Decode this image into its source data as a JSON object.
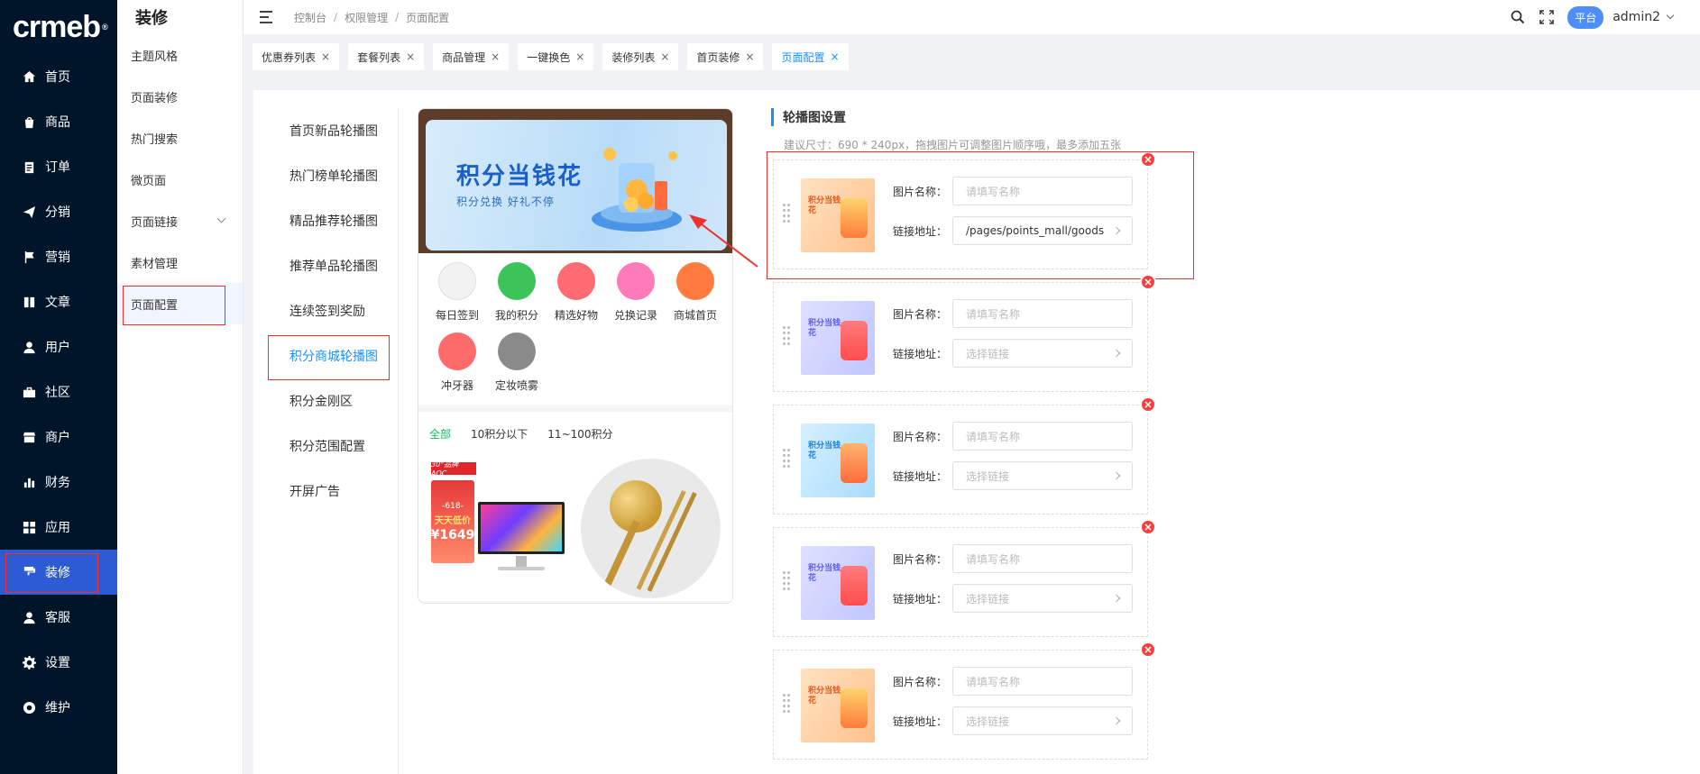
{
  "logo": "crmeb",
  "logo_mark": "®",
  "nav": {
    "items": [
      {
        "label": "首页",
        "icon": "home-icon"
      },
      {
        "label": "商品",
        "icon": "shopping-bag-icon"
      },
      {
        "label": "订单",
        "icon": "clipboard-icon"
      },
      {
        "label": "分销",
        "icon": "paper-plane-icon"
      },
      {
        "label": "营销",
        "icon": "flag-icon"
      },
      {
        "label": "文章",
        "icon": "book-icon"
      },
      {
        "label": "用户",
        "icon": "user-icon"
      },
      {
        "label": "社区",
        "icon": "briefcase-icon"
      },
      {
        "label": "商户",
        "icon": "store-icon"
      },
      {
        "label": "财务",
        "icon": "bar-chart-icon"
      },
      {
        "label": "应用",
        "icon": "apps-icon"
      },
      {
        "label": "装修",
        "icon": "paint-roller-icon"
      },
      {
        "label": "客服",
        "icon": "headset-icon"
      },
      {
        "label": "设置",
        "icon": "gear-icon"
      },
      {
        "label": "维护",
        "icon": "wrench-icon"
      }
    ]
  },
  "subnav": {
    "title": "装修",
    "items": [
      {
        "label": "主题风格"
      },
      {
        "label": "页面装修"
      },
      {
        "label": "热门搜索"
      },
      {
        "label": "微页面"
      },
      {
        "label": "页面链接"
      },
      {
        "label": "素材管理"
      },
      {
        "label": "页面配置"
      }
    ]
  },
  "header": {
    "breadcrumbs": [
      "控制台",
      "权限管理",
      "页面配置"
    ],
    "separator": "/",
    "platform_label": "平台",
    "user_name": "admin2"
  },
  "tabs": [
    {
      "label": "优惠券列表"
    },
    {
      "label": "套餐列表"
    },
    {
      "label": "商品管理"
    },
    {
      "label": "一键换色"
    },
    {
      "label": "装修列表"
    },
    {
      "label": "首页装修"
    },
    {
      "label": "页面配置"
    }
  ],
  "tab_close": "×",
  "config_list": [
    {
      "label": "首页新品轮播图"
    },
    {
      "label": "热门榜单轮播图"
    },
    {
      "label": "精品推荐轮播图"
    },
    {
      "label": "推荐单品轮播图"
    },
    {
      "label": "连续签到奖励"
    },
    {
      "label": "积分商城轮播图"
    },
    {
      "label": "积分金刚区"
    },
    {
      "label": "积分范围配置"
    },
    {
      "label": "开屏广告"
    }
  ],
  "preview": {
    "banner_title": "积分当钱花",
    "banner_subtitle": "积分兑换  好礼不停",
    "icons": [
      {
        "label": "每日签到",
        "color": "#f2f2f2"
      },
      {
        "label": "我的积分",
        "color": "#3cc35a"
      },
      {
        "label": "精选好物",
        "color": "#ff6b73"
      },
      {
        "label": "兑换记录",
        "color": "#ff7ab8"
      },
      {
        "label": "商城首页",
        "color": "#ff7a3d"
      },
      {
        "label": "冲牙器",
        "color": "#ff6b6b"
      },
      {
        "label": "定妆喷雾",
        "color": "#8a8a8a"
      }
    ],
    "categories": [
      "全部",
      "10积分以下",
      "11~100积分"
    ],
    "product_badge": "30°品牌 AOC",
    "poster_618": "-618-",
    "poster_text": "天天低价",
    "poster_price": "¥1649"
  },
  "settings": {
    "title": "轮播图设置",
    "hint": "建议尺寸：690 * 240px，拖拽图片可调整图片顺序哦，最多添加五张",
    "name_label": "图片名称：",
    "link_label": "链接地址：",
    "name_placeholder": "请填写名称",
    "link_placeholder": "选择链接",
    "thumb_text": "积分当钱花",
    "delete_glyph": "×",
    "slides": [
      {
        "theme": "orange",
        "name": "",
        "link": "/pages/points_mall/goods"
      },
      {
        "theme": "purple",
        "name": "",
        "link": ""
      },
      {
        "theme": "blue",
        "name": "",
        "link": ""
      },
      {
        "theme": "purple",
        "name": "",
        "link": ""
      },
      {
        "theme": "orange",
        "name": "",
        "link": ""
      }
    ]
  },
  "colors": {
    "sidebar_bg": "#001529",
    "active_blue": "#2d5bd6",
    "accent": "#1890ff",
    "highlight_red": "#f0302f"
  }
}
